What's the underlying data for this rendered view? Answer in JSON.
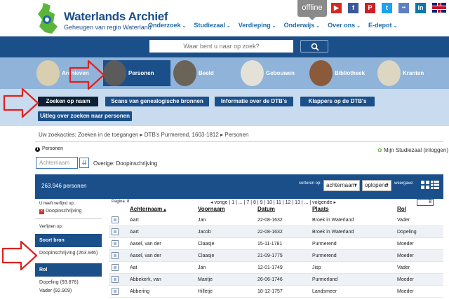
{
  "header": {
    "logo_title": "Waterlands Archief",
    "logo_subtitle": "Geheugen van regio Waterland",
    "offline_label": "offline",
    "nav": [
      {
        "label": "Onderzoek"
      },
      {
        "label": "Studiezaal"
      },
      {
        "label": "Verdieping"
      },
      {
        "label": "Onderwijs"
      },
      {
        "label": "Over ons"
      },
      {
        "label": "E-depot"
      }
    ],
    "social": [
      {
        "icon": "youtube-icon",
        "glyph": "▶",
        "color": "#d62a1e"
      },
      {
        "icon": "facebook-icon",
        "glyph": "f",
        "color": "#3b5998"
      },
      {
        "icon": "pinterest-icon",
        "glyph": "P",
        "color": "#cb2027"
      },
      {
        "icon": "twitter-icon",
        "glyph": "t",
        "color": "#1da1f2"
      },
      {
        "icon": "flickr-icon",
        "glyph": "••",
        "color": "#5f7fc0"
      },
      {
        "icon": "linkedin-icon",
        "glyph": "in",
        "color": "#0e76a8"
      }
    ]
  },
  "search": {
    "placeholder": "Waar bent u naar op zoek?"
  },
  "categories": [
    {
      "label": "Archieven",
      "active": false
    },
    {
      "label": "Personen",
      "active": true
    },
    {
      "label": "Beeld",
      "active": false
    },
    {
      "label": "Gebouwen",
      "active": false
    },
    {
      "label": "Bibliotheek",
      "active": false
    },
    {
      "label": "Kranten",
      "active": false
    }
  ],
  "tabs": [
    {
      "label": "Zoeken op naam",
      "active": true
    },
    {
      "label": "Scans van genealogische bronnen",
      "active": false
    },
    {
      "label": "Informatie over de DTB's",
      "active": false
    },
    {
      "label": "Klappers op de DTB's",
      "active": false
    },
    {
      "label": "Uitleg over zoeken naar personen",
      "active": false
    }
  ],
  "breadcrumb": "Uw zoekacties: Zoeken in de toegangen ▸ DTB's Purmerend, 1603-1812 ▸ Personen",
  "info_title": "Personen",
  "studiezaal_link": "Mijn Studiezaal (inloggen)",
  "name_input_placeholder": "Achternaam",
  "overige": "Overige: Doopinschrijving",
  "results": {
    "count": "263.946 personen",
    "sort_label": "sorteren op:",
    "sort_field": "achternaam",
    "sort_order": "oplopend",
    "view_label": "weergave:"
  },
  "sidebar": {
    "verfijnd_label": "U heeft verfijnd op:",
    "verfijnd_value": "Doopinschrijving",
    "verfijnen_label": "Verfijnen op:",
    "soort_bron_head": "Soort bron",
    "soort_bron_item": "Doopinschrijving (263.946)",
    "rol_head": "Rol",
    "rol_items": [
      "Dopeling (93.876)",
      "Vader (92.909)"
    ]
  },
  "table": {
    "pagina": "Pagina: 8",
    "pager": "◂ vorige | 1 | ... | 7 | 8 | 9 | 10 | 11 | 12 | 13 | ... | volgende ▸",
    "page_box": "8",
    "headers": [
      "Achternaam",
      "Voornaam",
      "Datum",
      "Plaats",
      "Rol"
    ],
    "rows": [
      {
        "achternaam": "Aart",
        "voornaam": "Jan",
        "datum": "22-08-1632",
        "plaats": "Broek in Waterland",
        "rol": "Vader"
      },
      {
        "achternaam": "Aart",
        "voornaam": "Jacob",
        "datum": "22-08-1632",
        "plaats": "Broek in Waterland",
        "rol": "Dopeling"
      },
      {
        "achternaam": "Aasel, van der",
        "voornaam": "Claasje",
        "datum": "15-11-1781",
        "plaats": "Purmerend",
        "rol": "Moeder"
      },
      {
        "achternaam": "Aasel, van der",
        "voornaam": "Claasje",
        "datum": "21-09-1775",
        "plaats": "Purmerend",
        "rol": "Moeder"
      },
      {
        "achternaam": "Aat",
        "voornaam": "Jan",
        "datum": "12-01-1749",
        "plaats": "Jisp",
        "rol": "Vader"
      },
      {
        "achternaam": "Abbekerk, van",
        "voornaam": "Maritje",
        "datum": "26-06-1746",
        "plaats": "Purmerland",
        "rol": "Moeder"
      },
      {
        "achternaam": "Abbering",
        "voornaam": "Hilletje",
        "datum": "18-12-1757",
        "plaats": "Landsmeer",
        "rol": "Moeder"
      }
    ]
  }
}
